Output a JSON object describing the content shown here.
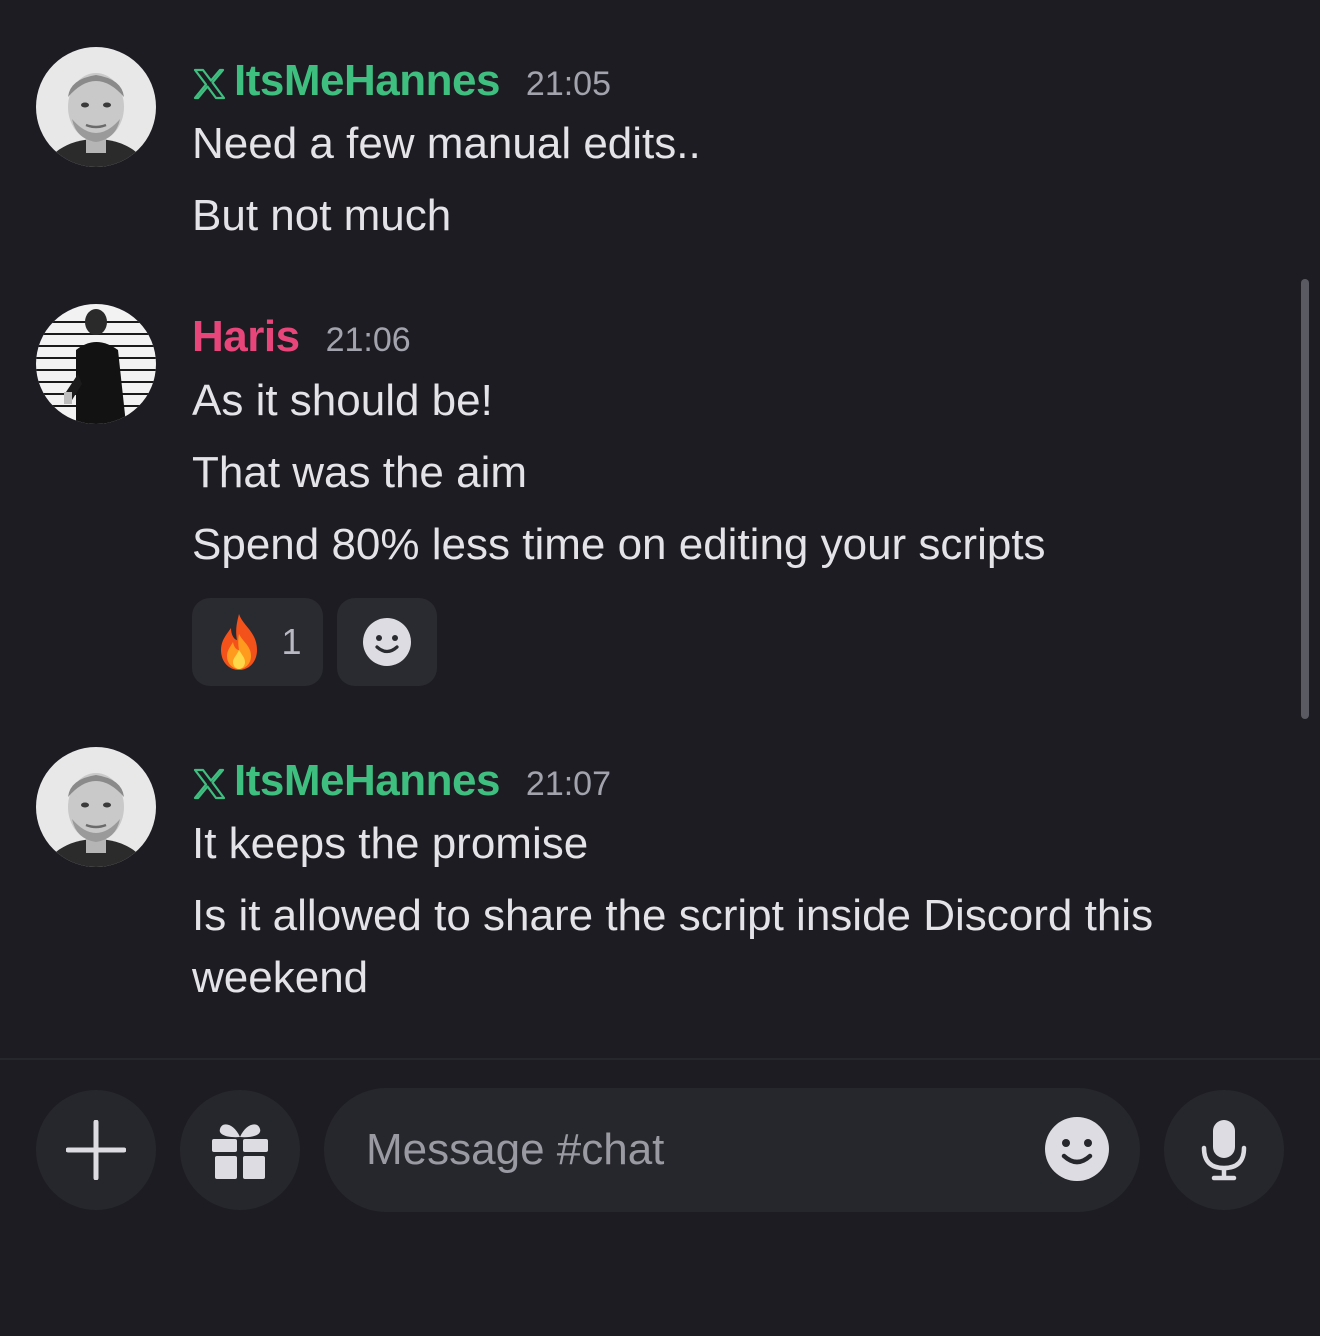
{
  "messages": [
    {
      "author": "ItsMeHannes",
      "time": "21:05",
      "lines": [
        "Need a few manual edits..",
        "But not much"
      ]
    },
    {
      "author": "Haris",
      "time": "21:06",
      "lines": [
        "As it should be!",
        "That was the aim",
        "Spend 80% less time on editing your scripts"
      ],
      "reactions": [
        {
          "emoji": "fire-icon",
          "count": "1"
        },
        {
          "emoji": "add-reaction-icon"
        }
      ]
    },
    {
      "author": "ItsMeHannes",
      "time": "21:07",
      "lines": [
        "It keeps the promise",
        "Is it allowed to share the script inside Discord this weekend"
      ]
    }
  ],
  "composer": {
    "placeholder": "Message #chat"
  },
  "colors": {
    "background": "#1c1c22",
    "author_green": "#3fbf7f",
    "author_pink": "#e8457b"
  }
}
